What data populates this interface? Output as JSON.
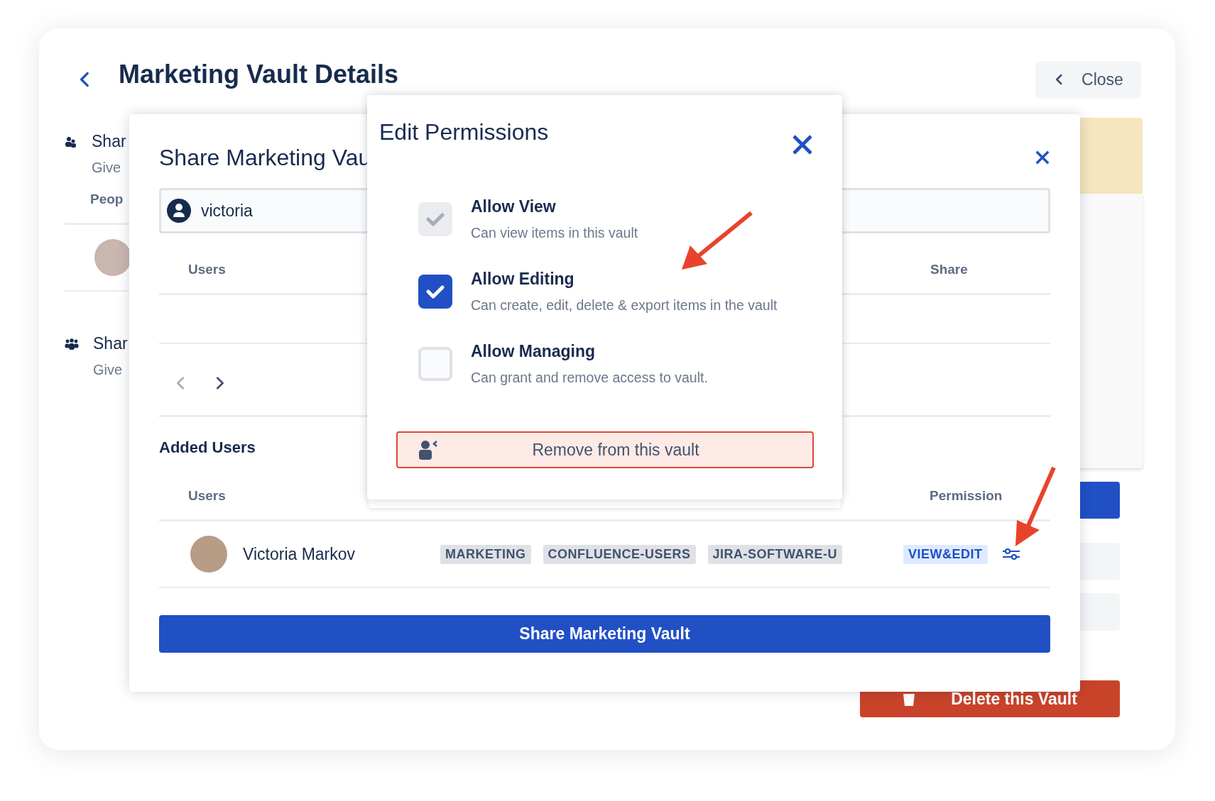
{
  "page": {
    "title": "Marketing Vault Details",
    "close_button": "Close",
    "delete_button": "Delete this Vault"
  },
  "sections": [
    {
      "kind": "people",
      "title": "Shar",
      "subtitle": "Give",
      "column": "Peop"
    },
    {
      "kind": "groups",
      "title": "Shar",
      "subtitle": "Give"
    }
  ],
  "share_dialog": {
    "title": "Share Marketing Vau",
    "search": {
      "value": "victoria"
    },
    "results_columns": [
      "Users",
      "Share"
    ],
    "added_title": "Added Users",
    "added_columns": [
      "Users",
      "Permission"
    ],
    "rows": [
      {
        "name": "Victoria Markov",
        "groups": [
          "MARKETING",
          "CONFLUENCE-USERS",
          "JIRA-SOFTWARE-U"
        ],
        "permission": "VIEW&EDIT"
      }
    ],
    "submit_button": "Share Marketing Vault"
  },
  "edit_dialog": {
    "title": "Edit Permissions",
    "options": [
      {
        "label": "Allow View",
        "description": "Can view items in this vault",
        "checked": true,
        "disabled": true
      },
      {
        "label": "Allow Editing",
        "description": "Can create, edit, delete & export items in the vault",
        "checked": true,
        "disabled": false
      },
      {
        "label": "Allow Managing",
        "description": "Can grant and remove access to vault.",
        "checked": false,
        "disabled": false
      }
    ],
    "remove_button": "Remove from this vault"
  }
}
